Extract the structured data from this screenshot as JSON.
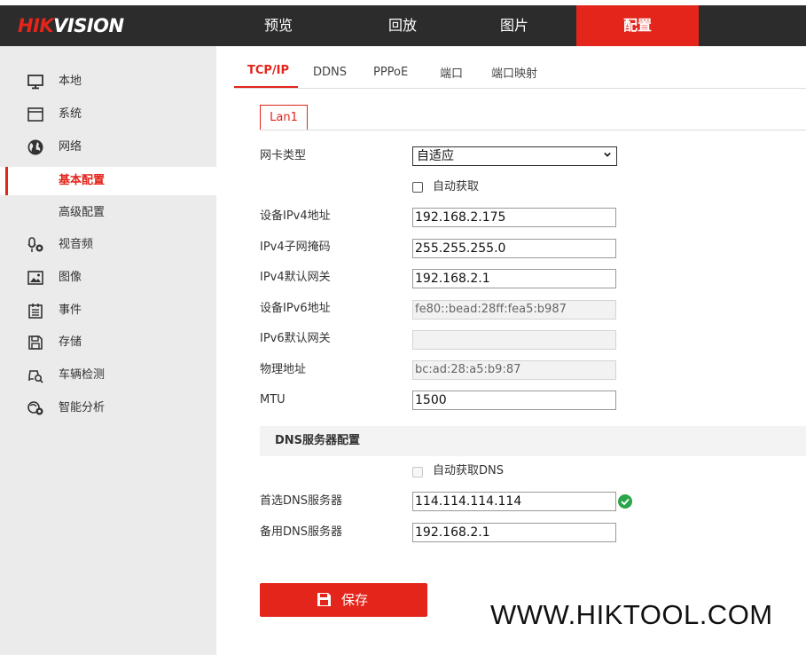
{
  "brand": {
    "logo_red": "HIK",
    "logo_white": "VISION"
  },
  "nav": {
    "items": [
      "预览",
      "回放",
      "图片",
      "配置"
    ],
    "active": "配置"
  },
  "sidebar": {
    "items": [
      {
        "label": "本地",
        "icon": "monitor-icon"
      },
      {
        "label": "系统",
        "icon": "window-icon"
      },
      {
        "label": "网络",
        "icon": "globe-icon"
      },
      {
        "label": "基本配置",
        "icon": ""
      },
      {
        "label": "高级配置",
        "icon": ""
      },
      {
        "label": "视音频",
        "icon": "camera-audio-icon"
      },
      {
        "label": "图像",
        "icon": "image-icon"
      },
      {
        "label": "事件",
        "icon": "calendar-icon"
      },
      {
        "label": "存储",
        "icon": "save-icon"
      },
      {
        "label": "车辆检测",
        "icon": "vehicle-search-icon"
      },
      {
        "label": "智能分析",
        "icon": "smart-analysis-icon"
      }
    ],
    "active": "基本配置"
  },
  "tabs": {
    "items": [
      "TCP/IP",
      "DDNS",
      "PPPoE",
      "端口",
      "端口映射"
    ],
    "active": "TCP/IP"
  },
  "lan_tab": "Lan1",
  "form": {
    "nic_type_label": "网卡类型",
    "nic_type_value": "自适应",
    "auto_obtain_label": "自动获取",
    "ipv4_addr_label": "设备IPv4地址",
    "ipv4_addr_value": "192.168.2.175",
    "ipv4_mask_label": "IPv4子网掩码",
    "ipv4_mask_value": "255.255.255.0",
    "ipv4_gw_label": "IPv4默认网关",
    "ipv4_gw_value": "192.168.2.1",
    "ipv6_addr_label": "设备IPv6地址",
    "ipv6_addr_value": "fe80::bead:28ff:fea5:b987",
    "ipv6_gw_label": "IPv6默认网关",
    "ipv6_gw_value": "",
    "mac_label": "物理地址",
    "mac_value": "bc:ad:28:a5:b9:87",
    "mtu_label": "MTU",
    "mtu_value": "1500"
  },
  "dns": {
    "section_title": "DNS服务器配置",
    "auto_dns_label": "自动获取DNS",
    "preferred_label": "首选DNS服务器",
    "preferred_value": "114.114.114.114",
    "alternate_label": "备用DNS服务器",
    "alternate_value": "192.168.2.1"
  },
  "save_label": "保存",
  "watermark": "WWW.HIKTOOL.COM",
  "colors": {
    "accent": "#e3251b",
    "header": "#2c2c2c",
    "sidebar": "#ebebeb",
    "ok": "#2aa54a"
  }
}
